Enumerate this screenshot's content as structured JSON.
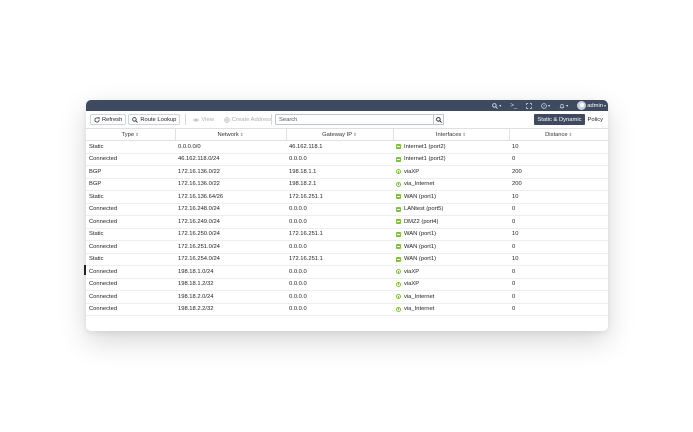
{
  "topbar": {
    "icons": [
      "search-icon",
      "terminal-icon",
      "fullscreen-icon",
      "help-icon",
      "bell-icon"
    ],
    "user_label": "admin"
  },
  "toolbar": {
    "refresh_label": "Refresh",
    "route_lookup_label": "Route Lookup",
    "view_label": "View",
    "create_address_label": "Create Address",
    "search_placeholder": "Search",
    "tab_static_dynamic": "Static & Dynamic",
    "tab_policy": "Policy"
  },
  "table": {
    "columns": [
      "Type",
      "Network",
      "Gateway IP",
      "Interfaces",
      "Distance"
    ],
    "rows": [
      {
        "type": "Static",
        "network": "0.0.0.0/0",
        "gateway": "46.162.118.1",
        "interface": "Internet1 (port2)",
        "icon": "port-icon",
        "distance": "10"
      },
      {
        "type": "Connected",
        "network": "46.162.118.0/24",
        "gateway": "0.0.0.0",
        "interface": "Internet1 (port2)",
        "icon": "port-icon",
        "distance": "0"
      },
      {
        "type": "BGP",
        "network": "172.16.136.0/22",
        "gateway": "198.18.1.1",
        "interface": "viaXP",
        "icon": "vpn-icon",
        "distance": "200"
      },
      {
        "type": "BGP",
        "network": "172.16.136.0/22",
        "gateway": "198.18.2.1",
        "interface": "via_Internet",
        "icon": "vpn-icon",
        "distance": "200"
      },
      {
        "type": "Static",
        "network": "172.16.136.64/26",
        "gateway": "172.16.251.1",
        "interface": "WAN (port1)",
        "icon": "port-icon",
        "distance": "10"
      },
      {
        "type": "Connected",
        "network": "172.16.248.0/24",
        "gateway": "0.0.0.0",
        "interface": "LANtest (port5)",
        "icon": "port-icon",
        "distance": "0"
      },
      {
        "type": "Connected",
        "network": "172.16.249.0/24",
        "gateway": "0.0.0.0",
        "interface": "DMZ2 (port4)",
        "icon": "port-icon",
        "distance": "0"
      },
      {
        "type": "Static",
        "network": "172.16.250.0/24",
        "gateway": "172.16.251.1",
        "interface": "WAN (port1)",
        "icon": "port-icon",
        "distance": "10"
      },
      {
        "type": "Connected",
        "network": "172.16.251.0/24",
        "gateway": "0.0.0.0",
        "interface": "WAN (port1)",
        "icon": "port-icon",
        "distance": "0"
      },
      {
        "type": "Static",
        "network": "172.16.254.0/24",
        "gateway": "172.16.251.1",
        "interface": "WAN (port1)",
        "icon": "port-icon",
        "distance": "10"
      },
      {
        "type": "Connected",
        "network": "198.18.1.0/24",
        "gateway": "0.0.0.0",
        "interface": "viaXP",
        "icon": "vpn-icon",
        "distance": "0"
      },
      {
        "type": "Connected",
        "network": "198.18.1.2/32",
        "gateway": "0.0.0.0",
        "interface": "viaXP",
        "icon": "vpn-icon",
        "distance": "0"
      },
      {
        "type": "Connected",
        "network": "198.18.2.0/24",
        "gateway": "0.0.0.0",
        "interface": "via_Internet",
        "icon": "vpn-icon",
        "distance": "0"
      },
      {
        "type": "Connected",
        "network": "198.18.2.2/32",
        "gateway": "0.0.0.0",
        "interface": "via_Internet",
        "icon": "vpn-icon",
        "distance": "0"
      }
    ]
  },
  "colors": {
    "topbar_bg": "#3d4a5f",
    "active_tab_bg": "#3d4a5f",
    "interface_icon": "#7cc242"
  }
}
